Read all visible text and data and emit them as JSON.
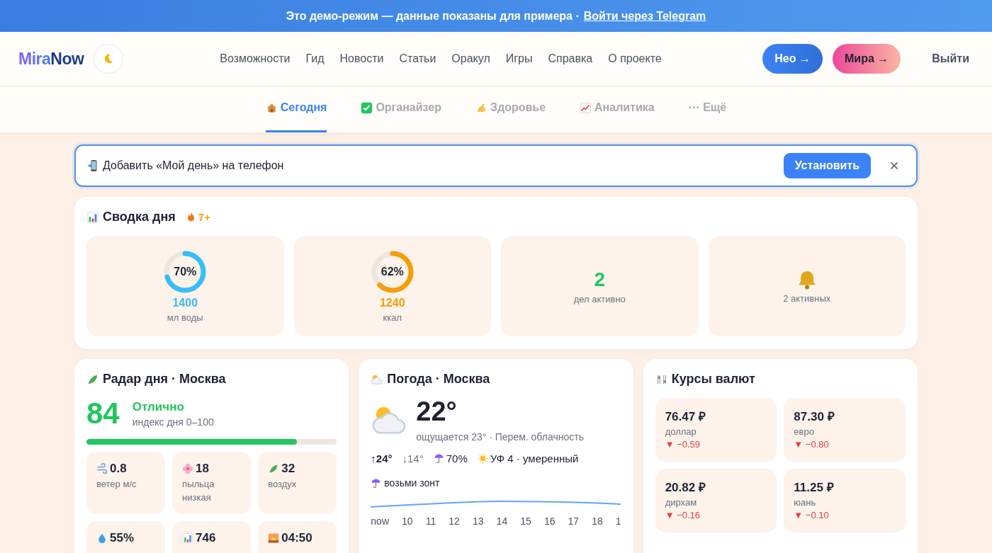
{
  "banner": {
    "text": "Это демо-режим — данные показаны для примера ·",
    "link": "Войти через Telegram"
  },
  "header": {
    "logo_first": "Mira",
    "logo_second": "Now",
    "nav": [
      "Возможности",
      "Гид",
      "Новости",
      "Статьи",
      "Оракул",
      "Игры",
      "Справка",
      "О проекте"
    ],
    "buttons": [
      {
        "label": "Нео →",
        "kind": "neo"
      },
      {
        "label": "Мира →",
        "kind": "mira"
      }
    ],
    "logout": "Выйти"
  },
  "tabs": [
    {
      "label": "Сегодня",
      "selected": true
    },
    {
      "label": "Органайзер",
      "selected": false
    },
    {
      "label": "Здоровье",
      "selected": false
    },
    {
      "label": "Аналитика",
      "selected": false
    },
    {
      "label": "··· Ещё",
      "selected": false
    }
  ],
  "install": {
    "text": "Добавить «Мой день» на телефон",
    "button": "Установить"
  },
  "summary": {
    "title": "Сводка дня",
    "streak": "7+",
    "tiles": [
      {
        "kind": "ring",
        "percent": "70%",
        "level": 0.7,
        "value": "1400",
        "label": "мл воды",
        "color": "#38bdf8"
      },
      {
        "kind": "ring",
        "percent": "62%",
        "level": 0.62,
        "value": "1240",
        "label": "ккал",
        "color": "#f59e0b"
      },
      {
        "kind": "count",
        "value": "2",
        "label": "дел активно"
      },
      {
        "kind": "bell",
        "label": "2 активных"
      }
    ]
  },
  "radar": {
    "title": "Радар дня · Москва",
    "score": "84",
    "verdict": "Отлично",
    "caption": "индекс дня 0–100",
    "level": 0.84,
    "metrics": [
      {
        "value": "0.8",
        "label": "ветер м/с"
      },
      {
        "value": "18",
        "label": "пыльца низкая"
      },
      {
        "value": "32",
        "label": "воздух"
      },
      {
        "value": "55%"
      },
      {
        "value": "746"
      },
      {
        "value": "04:50"
      }
    ]
  },
  "weather": {
    "title": "Погода · Москва",
    "temp": "22°",
    "feels": "ощущается 23° · Перем. облачность",
    "high": "↑24°",
    "low": "↓14°",
    "rain": "70%",
    "uv": "УФ 4 · умеренный",
    "advice": "возьми зонт",
    "hours": [
      "now",
      "10",
      "11",
      "12",
      "13",
      "14",
      "15",
      "16",
      "17",
      "18",
      "1"
    ]
  },
  "currency": {
    "title": "Курсы валют",
    "rates": [
      {
        "value": "76.47 ₽",
        "name": "доллар",
        "change": "▼ −0.59"
      },
      {
        "value": "87.30 ₽",
        "name": "евро",
        "change": "▼ −0.80"
      },
      {
        "value": "20.82 ₽",
        "name": "дирхам",
        "change": "▼ −0.16"
      },
      {
        "value": "11.25 ₽",
        "name": "юань",
        "change": "▼ −0.10"
      }
    ]
  }
}
